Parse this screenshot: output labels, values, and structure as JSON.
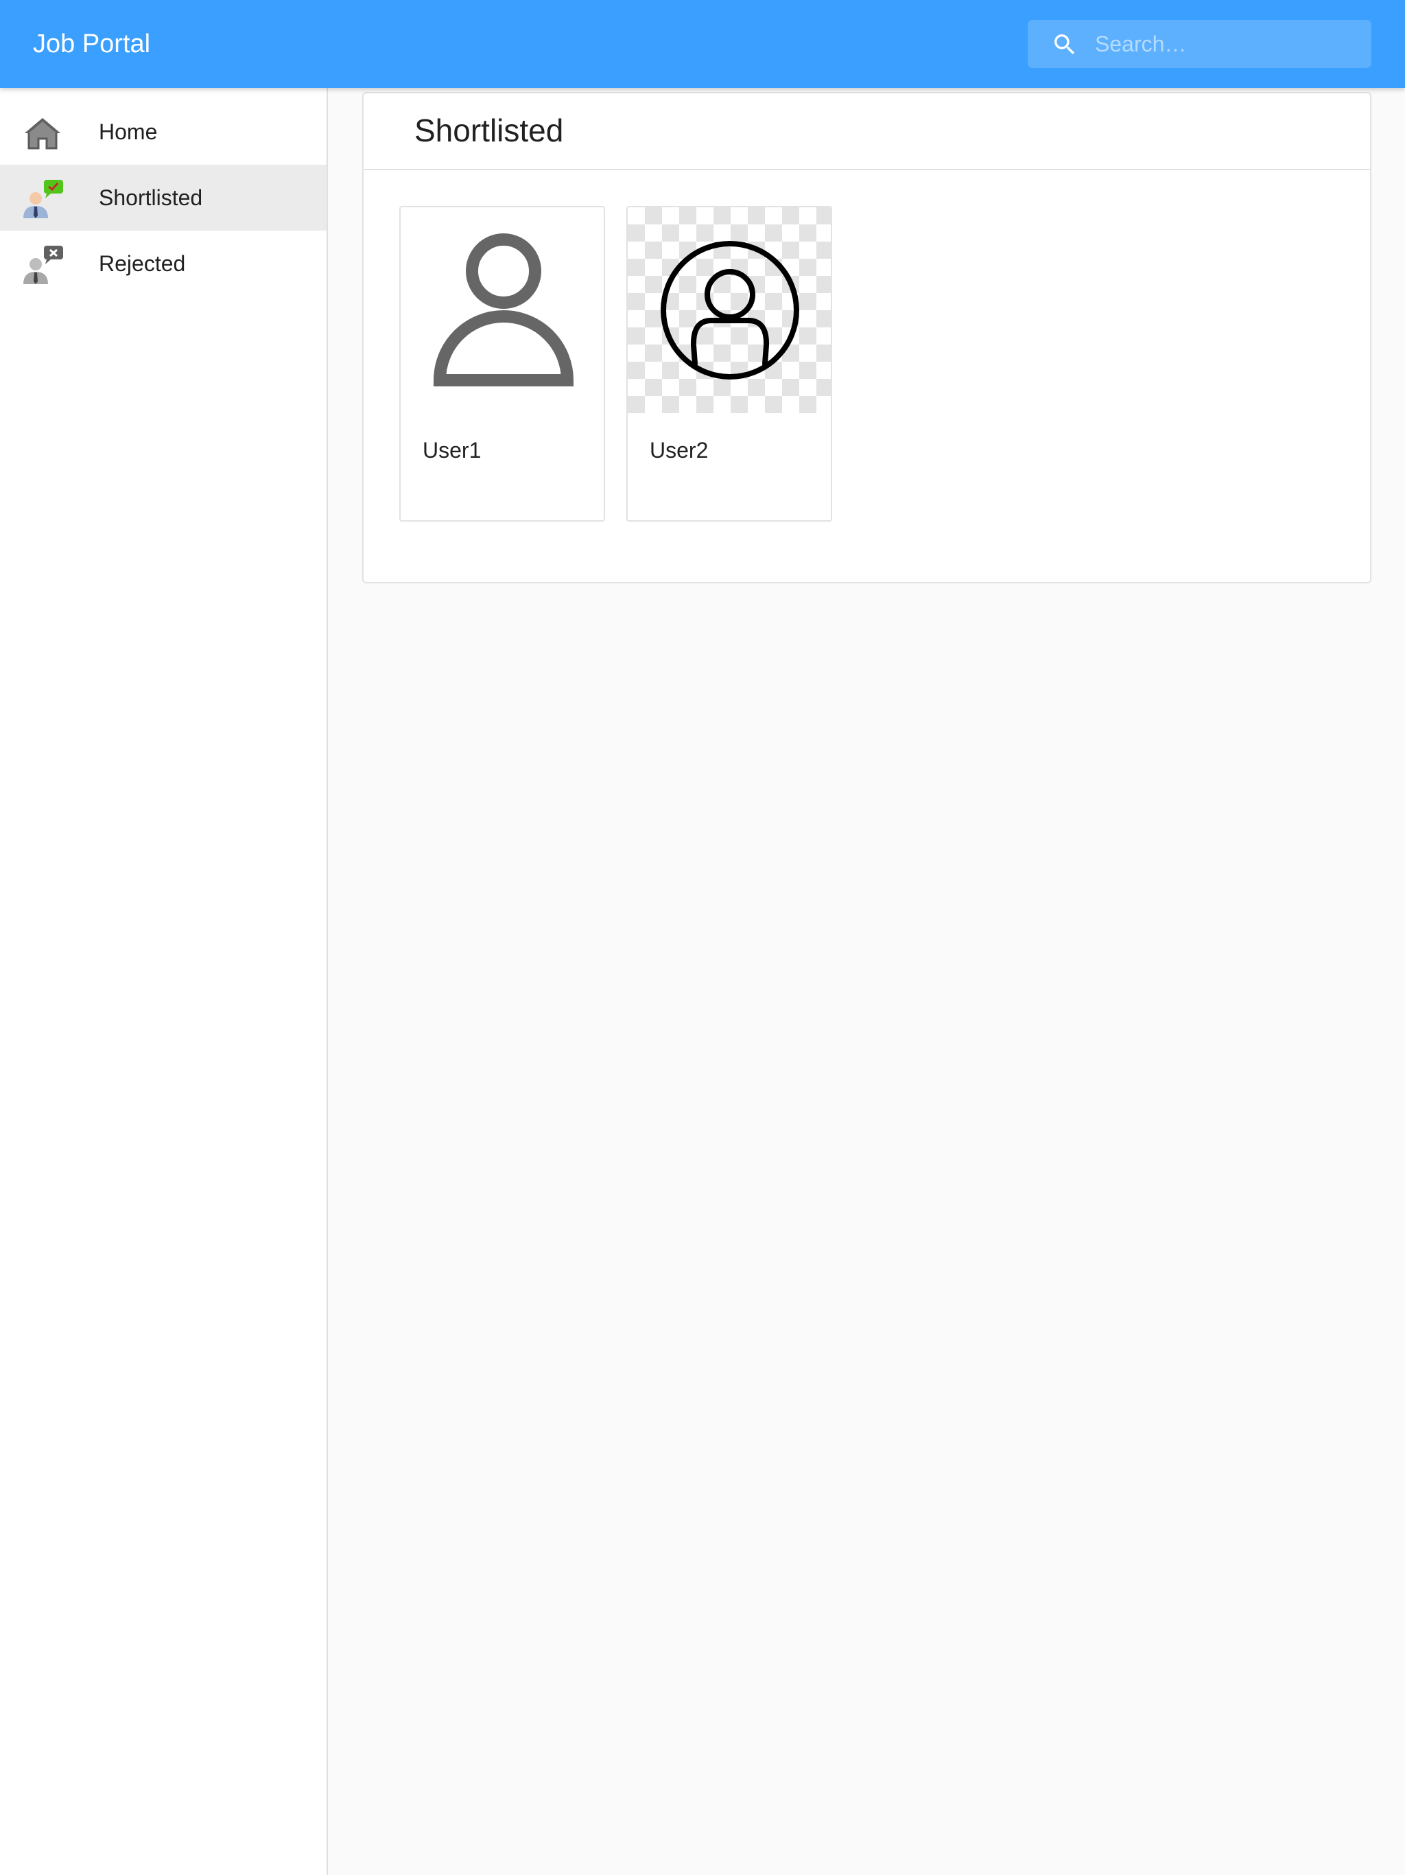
{
  "app": {
    "title": "Job Portal"
  },
  "search": {
    "placeholder": "Search…",
    "icon": "search-icon"
  },
  "sidebar": {
    "items": [
      {
        "label": "Home",
        "icon": "home-icon",
        "active": false
      },
      {
        "label": "Shortlisted",
        "icon": "shortlisted-user-icon",
        "active": true
      },
      {
        "label": "Rejected",
        "icon": "rejected-user-icon",
        "active": false
      }
    ]
  },
  "main": {
    "title": "Shortlisted",
    "users": [
      {
        "name": "User1",
        "avatar": "person-icon"
      },
      {
        "name": "User2",
        "avatar": "person-circle-icon"
      }
    ]
  },
  "colors": {
    "appbar": "#3a9ffe",
    "search_bg": "#5cb0fe",
    "active_nav": "#ebebeb",
    "page_bg": "#fafafa",
    "shortlisted_badge": "#52c41a",
    "rejected_badge": "#616161"
  }
}
